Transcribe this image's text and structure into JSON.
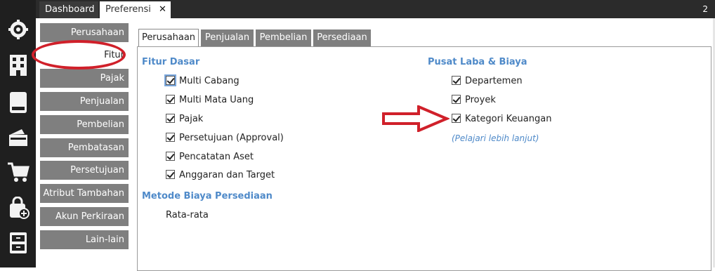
{
  "top_tabs": {
    "dashboard": "Dashboard",
    "preferensi": "Preferensi",
    "close": "✕",
    "page_count": "2"
  },
  "rail_icons": [
    "settings-icon",
    "company-icon",
    "book-icon",
    "wallet-icon",
    "cart-icon",
    "bag-add-icon",
    "cabinet-icon"
  ],
  "sidebar": {
    "items": [
      {
        "label": "Perusahaan"
      },
      {
        "label": "Fitur"
      },
      {
        "label": "Pajak"
      },
      {
        "label": "Penjualan"
      },
      {
        "label": "Pembelian"
      },
      {
        "label": "Pembatasan"
      },
      {
        "label": "Persetujuan"
      },
      {
        "label": "Atribut Tambahan"
      },
      {
        "label": "Akun Perkiraan"
      },
      {
        "label": "Lain-lain"
      }
    ]
  },
  "content_tabs": [
    {
      "label": "Perusahaan"
    },
    {
      "label": "Penjualan"
    },
    {
      "label": "Pembelian"
    },
    {
      "label": "Persediaan"
    }
  ],
  "fitur_dasar": {
    "title": "Fitur Dasar",
    "options": [
      {
        "label": "Multi Cabang",
        "checked": true
      },
      {
        "label": "Multi Mata Uang",
        "checked": true
      },
      {
        "label": "Pajak",
        "checked": true
      },
      {
        "label": "Persetujuan (Approval)",
        "checked": true
      },
      {
        "label": "Pencatatan Aset",
        "checked": true
      },
      {
        "label": "Anggaran dan Target",
        "checked": true
      }
    ]
  },
  "metode": {
    "title": "Metode Biaya Persediaan",
    "value": "Rata-rata"
  },
  "pusat": {
    "title": "Pusat Laba & Biaya",
    "options": [
      {
        "label": "Departemen",
        "checked": true
      },
      {
        "label": "Proyek",
        "checked": true
      },
      {
        "label": "Kategori Keuangan",
        "checked": true
      }
    ],
    "link": "(Pelajari lebih lanjut)"
  },
  "colors": {
    "accent": "#4f8ac9",
    "sidebar_bg": "#7f7f7f",
    "annotation_red": "#d0202a",
    "rail_bg": "#1f1f1f"
  }
}
